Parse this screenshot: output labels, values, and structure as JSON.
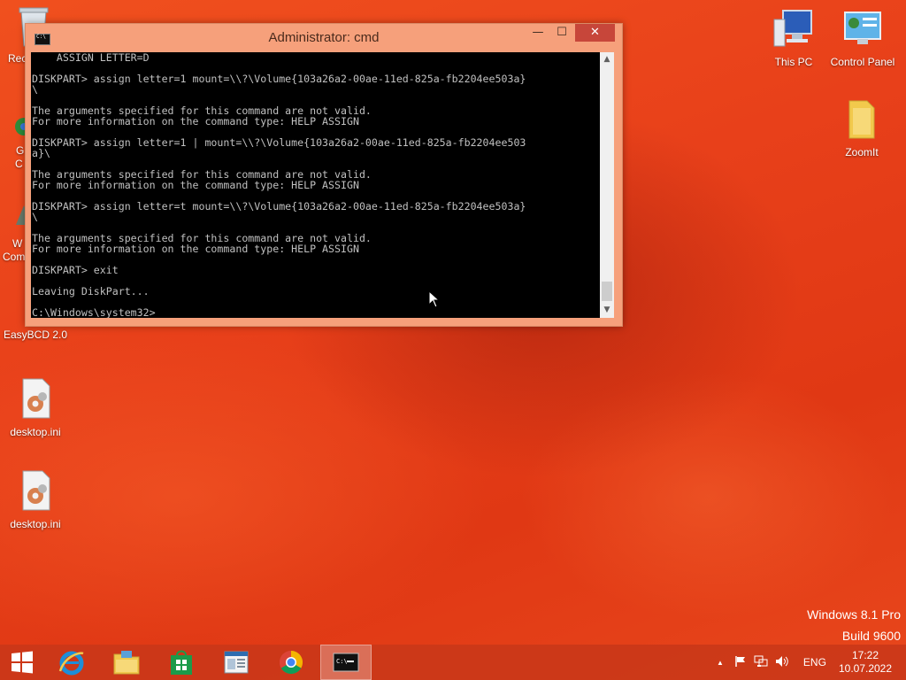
{
  "desktop_icons": [
    {
      "name": "This PC",
      "icon": "computer-icon"
    },
    {
      "name": "Control Panel",
      "icon": "control-panel-icon"
    },
    {
      "name": "ZoomIt",
      "icon": "folder-icon"
    },
    {
      "name": "EasyBCD 2.0",
      "icon": "easybcd-icon"
    },
    {
      "name": "desktop.ini",
      "icon": "settings-file-icon"
    },
    {
      "name": "desktop.ini",
      "icon": "settings-file-icon"
    }
  ],
  "partial_labels": {
    "recycle": "Rec",
    "g_line1": "G",
    "g_line2": "C",
    "w_line1": "W",
    "w_line2": "Com"
  },
  "cmd_window": {
    "title": "Administrator: cmd",
    "min_glyph": "—",
    "max_glyph": "☐",
    "close_glyph": "✕",
    "lines": [
      "    ASSIGN LETTER=D",
      "",
      "DISKPART> assign letter=1 mount=\\\\?\\Volume{103a26a2-00ae-11ed-825a-fb2204ee503a}",
      "\\",
      "",
      "The arguments specified for this command are not valid.",
      "For more information on the command type: HELP ASSIGN",
      "",
      "DISKPART> assign letter=1 | mount=\\\\?\\Volume{103a26a2-00ae-11ed-825a-fb2204ee503",
      "a}\\",
      "",
      "The arguments specified for this command are not valid.",
      "For more information on the command type: HELP ASSIGN",
      "",
      "DISKPART> assign letter=t mount=\\\\?\\Volume{103a26a2-00ae-11ed-825a-fb2204ee503a}",
      "\\",
      "",
      "The arguments specified for this command are not valid.",
      "For more information on the command type: HELP ASSIGN",
      "",
      "DISKPART> exit",
      "",
      "Leaving DiskPart...",
      "",
      "C:\\Windows\\system32>_"
    ]
  },
  "watermark": {
    "line1": "Windows 8.1 Pro",
    "line2": "Build 9600"
  },
  "taskbar": {
    "items": [
      "start-button",
      "internet-explorer-icon",
      "file-explorer-icon",
      "store-icon",
      "document-app-icon",
      "chrome-icon",
      "cmd-icon"
    ],
    "tray": {
      "chevron": "▲",
      "language": "ENG"
    },
    "clock": {
      "time": "17:22",
      "date": "10.07.2022"
    }
  },
  "colors": {
    "accent": "#e8401a",
    "close_button": "#c7463a",
    "window_frame": "#f6a07b",
    "console_text": "#c0c0c0"
  }
}
